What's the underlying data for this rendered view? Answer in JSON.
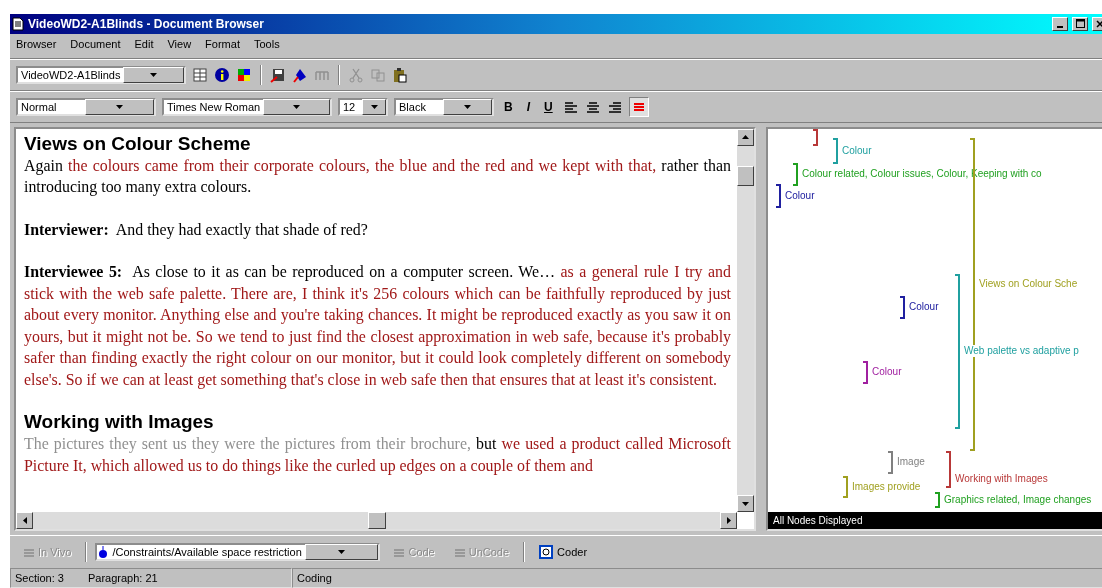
{
  "window": {
    "title": "VideoWD2-A1Blinds - Document Browser"
  },
  "menu": [
    "Browser",
    "Document",
    "Edit",
    "View",
    "Format",
    "Tools"
  ],
  "toolbar": {
    "document_select": "VideoWD2-A1Blinds"
  },
  "format_bar": {
    "style": "Normal",
    "font": "Times New Roman",
    "size": "12",
    "text_colour": "Black",
    "text_buttons": [
      "B",
      "I",
      "U"
    ],
    "colour_button_pressed": true
  },
  "document": {
    "sections": [
      {
        "heading": "Views on Colour Scheme",
        "paragraphs": [
          {
            "runs": [
              {
                "text": "Again ",
                "kind": "plain"
              },
              {
                "text": "the colours came from their corporate colours, the blue and the red and we kept with that,",
                "kind": "coded"
              },
              {
                "text": " rather than introducing too many extra colours.",
                "kind": "plain"
              }
            ]
          },
          {
            "speaker": "Interviewer:",
            "runs": [
              {
                "text": "And they had exactly that shade of red?",
                "kind": "plain"
              }
            ]
          },
          {
            "speaker": "Interviewee 5:",
            "runs": [
              {
                "text": "As close to it as can be reproduced on a computer screen.  We…",
                "kind": "plain"
              },
              {
                "text": " as a general rule I try and stick with the web safe palette.  There are, I think it's 256 colours which can be faithfully reproduced by just about every monitor.  Anything else and you're taking chances.  It might be reproduced exactly as you saw it on yours, but it might not be.  So we tend to just find the closest approximation in web safe, because it's probably safer than finding exactly the right colour on our monitor, but it could look completely different on somebody else's.  So if we can at least get something that's close in web safe then that ensures that at least it's consistent.",
                "kind": "coded"
              }
            ]
          }
        ]
      },
      {
        "heading": "Working with Images",
        "paragraphs": [
          {
            "runs": [
              {
                "text": "The pictures they sent us they were the pictures from their brochure,",
                "kind": "faded"
              },
              {
                "text": " but",
                "kind": "plain"
              },
              {
                "text": " we used a product called Microsoft Picture It, which allowed us to do things like the curled up edges on a couple of them and",
                "kind": "coded"
              }
            ]
          }
        ]
      }
    ]
  },
  "coding_stripes": {
    "stripes": [
      {
        "color": "#b83838"
      },
      {
        "label": "Colour",
        "color": "#20a0a0"
      },
      {
        "label": "Colour related, Colour issues, Colour, Keeping with co",
        "color": "#20a020"
      },
      {
        "label": "Colour",
        "color": "#2020a0"
      },
      {
        "label": "Views on Colour Sche",
        "color": "#a0a020"
      },
      {
        "label": "Web palette vs adaptive p",
        "color": "#20a0a0"
      },
      {
        "label": "Colour",
        "color": "#2020a0"
      },
      {
        "label": "Colour",
        "color": "#a020a0"
      },
      {
        "label": "Image",
        "color": "#808080"
      },
      {
        "label": "Images provide",
        "color": "#a0a020"
      },
      {
        "label": "Working with Images",
        "color": "#b83838"
      },
      {
        "label": "Graphics related, Image changes",
        "color": "#20a020"
      }
    ],
    "footer": "All Nodes Displayed"
  },
  "coding_bar": {
    "in_vivo": {
      "label": "In Vivo",
      "disabled": true
    },
    "node": "/Constraints/Available space restriction",
    "code": {
      "label": "Code",
      "disabled": true
    },
    "uncode": {
      "label": "UnCode",
      "disabled": true
    },
    "coder": {
      "label": "Coder",
      "disabled": false
    }
  },
  "status_bar": {
    "section": "Section: 3",
    "paragraph": "Paragraph: 21",
    "mode": "Coding"
  }
}
